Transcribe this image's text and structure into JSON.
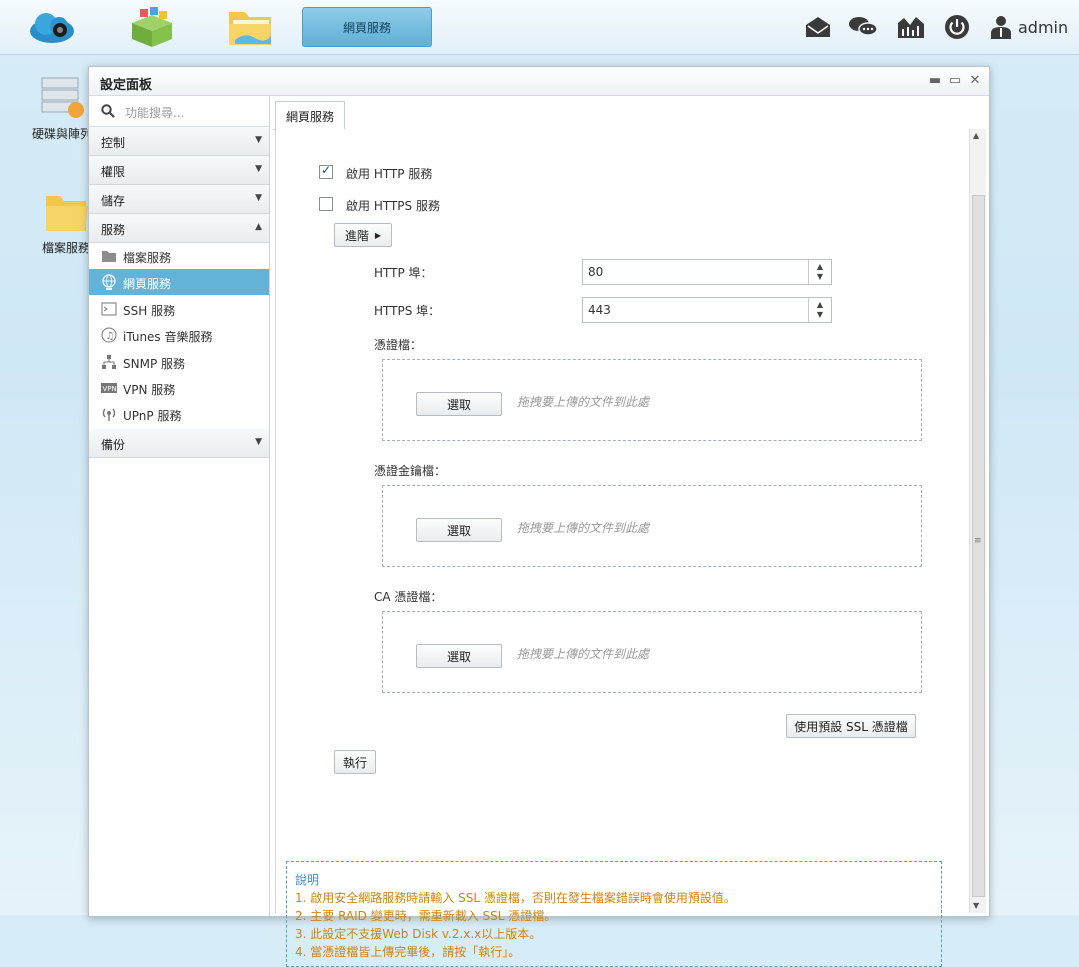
{
  "taskbar": {
    "active_task": "網頁服務",
    "user": "admin"
  },
  "desktop": {
    "icons": [
      {
        "label": "硬碟與陣列"
      },
      {
        "label": "檔案服務"
      }
    ]
  },
  "window": {
    "title": "設定面板"
  },
  "sidebar": {
    "search_placeholder": "功能搜尋...",
    "sections": [
      {
        "label": "控制",
        "expanded": false
      },
      {
        "label": "權限",
        "expanded": false
      },
      {
        "label": "儲存",
        "expanded": false
      },
      {
        "label": "服務",
        "expanded": true
      },
      {
        "label": "備份",
        "expanded": false
      }
    ],
    "service_items": [
      {
        "label": "檔案服務",
        "icon": "folder-icon"
      },
      {
        "label": "網頁服務",
        "icon": "globe-icon",
        "active": true
      },
      {
        "label": "SSH 服務",
        "icon": "terminal-icon"
      },
      {
        "label": "iTunes 音樂服務",
        "icon": "music-icon"
      },
      {
        "label": "SNMP 服務",
        "icon": "network-icon"
      },
      {
        "label": "VPN 服務",
        "icon": "vpn-icon"
      },
      {
        "label": "UPnP 服務",
        "icon": "upnp-icon"
      }
    ]
  },
  "tab": {
    "label": "網頁服務"
  },
  "form": {
    "http_enable": {
      "label": "啟用 HTTP 服務",
      "checked": true
    },
    "https_enable": {
      "label": "啟用 HTTPS 服務",
      "checked": false
    },
    "advanced_label": "進階",
    "http_port": {
      "label": "HTTP 埠：",
      "value": "80"
    },
    "https_port": {
      "label": "HTTPS 埠：",
      "value": "443"
    },
    "cert": {
      "label": "憑證檔：",
      "button": "選取",
      "hint": "拖拽要上傳的文件到此處"
    },
    "key": {
      "label": "憑證金鑰檔：",
      "button": "選取",
      "hint": "拖拽要上傳的文件到此處"
    },
    "ca": {
      "label": "CA 憑證檔：",
      "button": "選取",
      "hint": "拖拽要上傳的文件到此處"
    },
    "default_ssl_button": "使用預設 SSL 憑證檔",
    "apply_button": "執行"
  },
  "notes": {
    "heading": "說明",
    "lines": [
      "1. 啟用安全網路服務時請輸入 SSL 憑證檔，否則在發生檔案錯誤時會使用預設值。",
      "2. 主要 RAID 變更時，需重新載入 SSL 憑證檔。",
      "3. 此設定不支援Web Disk v.2.x.x以上版本。",
      "4. 當憑證檔皆上傳完畢後，請按「執行」。"
    ]
  },
  "colors": {
    "accent": "#63b3d9",
    "note_text": "#d0840a",
    "note_heading": "#3f8fc7"
  }
}
